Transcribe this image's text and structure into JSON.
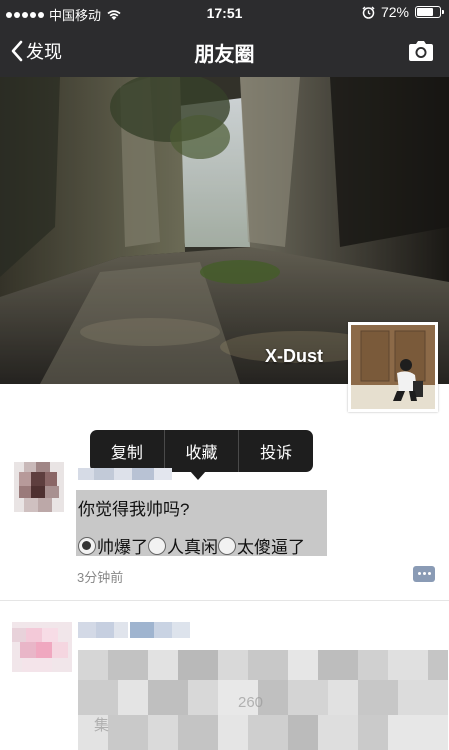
{
  "status_bar": {
    "carrier": "中国移动",
    "time": "17:51",
    "battery_percent": "72%",
    "battery_level": 0.72
  },
  "nav": {
    "back_label": "发现",
    "title": "朋友圈"
  },
  "cover": {
    "username": "X-Dust"
  },
  "context_menu": {
    "items": [
      "复制",
      "收藏",
      "投诉"
    ]
  },
  "post": {
    "text": "你觉得我帅吗?",
    "options": [
      "帅爆了",
      "人真闲",
      "太傻逼了"
    ],
    "selected_option": 0,
    "time": "3分钟前"
  },
  "post2": {
    "faint_text_1": "260",
    "faint_text_2": "集"
  },
  "colors": {
    "header_bg": "#2c2c2e",
    "menu_bg": "#1e1e1e",
    "post_highlight": "#c8c8c8",
    "comment_button": "#8a9bb5"
  }
}
